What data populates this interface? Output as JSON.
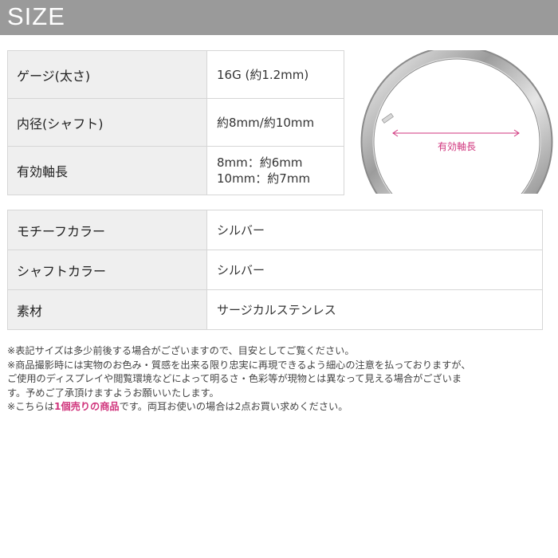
{
  "header": {
    "title": "SIZE"
  },
  "spec_table_1": [
    {
      "label": "ゲージ(太さ)",
      "value": "16G (約1.2mm)"
    },
    {
      "label": "内径(シャフト)",
      "value": "約8mm/約10mm"
    },
    {
      "label": "有効軸長",
      "value_lines": [
        "8mm：約6mm",
        "10mm：約7mm"
      ]
    }
  ],
  "spec_table_2": [
    {
      "label": "モチーフカラー",
      "value": "シルバー"
    },
    {
      "label": "シャフトカラー",
      "value": "シルバー"
    },
    {
      "label": "素材",
      "value": "サージカルステンレス"
    }
  ],
  "ring_image": {
    "annotation": "有効軸長",
    "accent_color": "#d0357d"
  },
  "notes": {
    "line1": "※表記サイズは多少前後する場合がございますので、目安としてご覧ください。",
    "line2": "※商品撮影時には実物のお色み・質感を出来る限り忠実に再現できるよう細心の注意を払っておりますが、",
    "line3": "ご使用のディスプレイや閲覧環境などによって明るさ・色彩等が現物とは異なって見える場合がございま",
    "line4": "す。予めご了承頂けますようお願いいたします。",
    "line5_prefix": "※こちらは",
    "line5_emphasis": "1個売りの商品",
    "line5_suffix": "です。両耳お使いの場合は2点お買い求めください。"
  }
}
